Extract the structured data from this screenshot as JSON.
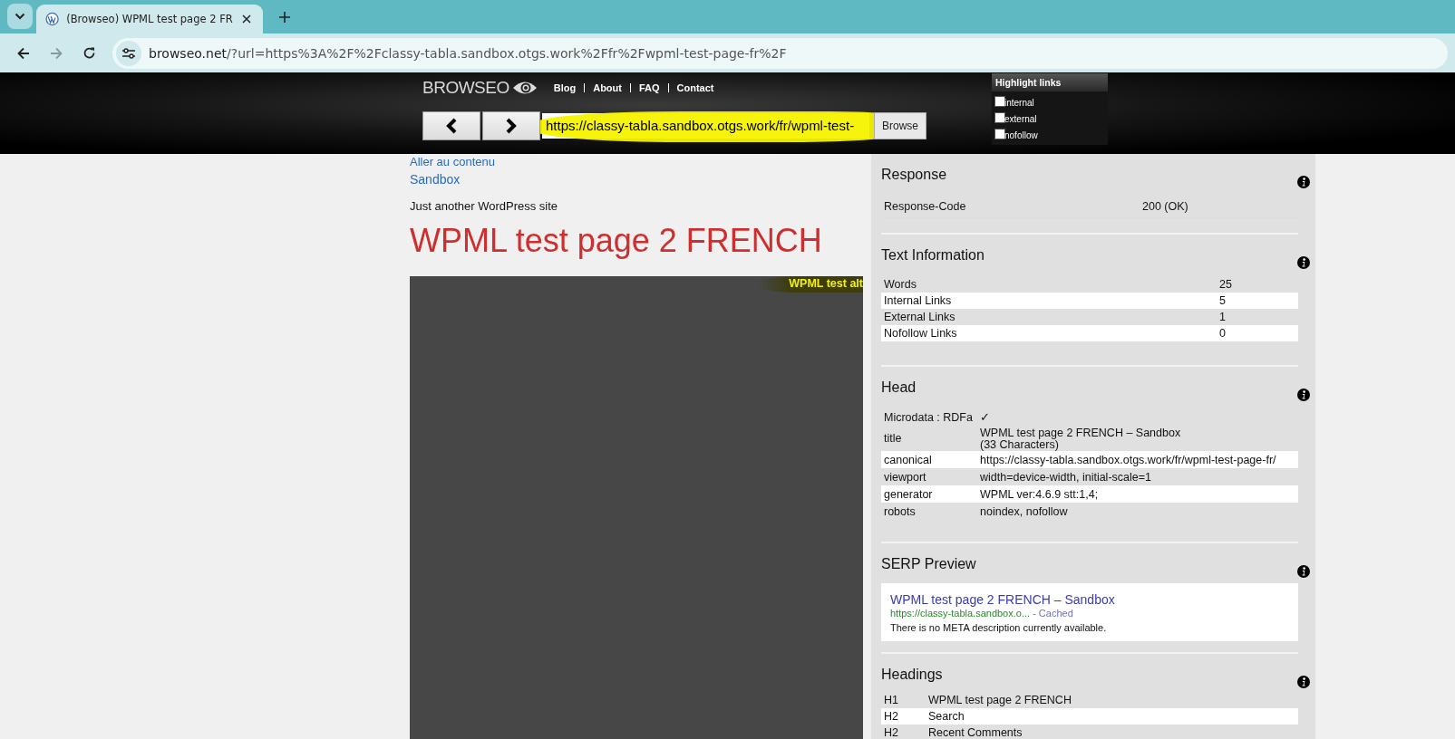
{
  "browser": {
    "tab": {
      "title": "(Browseo) WPML test page 2 FR"
    },
    "address": {
      "host": "browseo.net",
      "path": "/?url=https%3A%2F%2Fclassy-tabla.sandbox.otgs.work%2Ffr%2Fwpml-test-page-fr%2F"
    }
  },
  "header": {
    "logo": "BROWSEO",
    "nav": [
      "Blog",
      "About",
      "FAQ",
      "Contact"
    ],
    "url_field": {
      "value": "https://classy-tabla.sandbox.otgs.work/fr/wpml-test-"
    },
    "browse_button": "Browse",
    "highlight_links": {
      "title": "Highlight links",
      "options": [
        {
          "label": "internal",
          "checked": false
        },
        {
          "label": "external",
          "checked": false
        },
        {
          "label": "nofollow",
          "checked": false
        }
      ]
    }
  },
  "page": {
    "skip_link": "Aller au contenu",
    "site_title": "Sandbox",
    "tagline": "Just another WordPress site",
    "heading": "WPML test page 2 FRENCH",
    "image_alt": "WPML test alt"
  },
  "panel": [
    {
      "kind": "response",
      "title": "Response",
      "rows": [
        {
          "label": "Response-Code",
          "value": "200 (OK)"
        }
      ]
    },
    {
      "kind": "stats",
      "title": "Text Information",
      "rows": [
        {
          "label": "Words",
          "value": "25"
        },
        {
          "label": "Internal Links",
          "value": "5"
        },
        {
          "label": "External Links",
          "value": "1"
        },
        {
          "label": "Nofollow Links",
          "value": "0"
        }
      ]
    },
    {
      "kind": "head",
      "title": "Head",
      "rows": [
        {
          "label": "Microdata : RDFa",
          "value": "✓"
        },
        {
          "label": "title",
          "value": "WPML test page 2 FRENCH – Sandbox",
          "note": "(33 Characters)"
        },
        {
          "label": "canonical",
          "value": "https://classy-tabla.sandbox.otgs.work/fr/wpml-test-page-fr/"
        },
        {
          "label": "viewport",
          "value": "width=device-width, initial-scale=1"
        },
        {
          "label": "generator",
          "value": "WPML ver:4.6.9 stt:1,4;"
        },
        {
          "label": "robots",
          "value": "noindex, nofollow"
        }
      ]
    },
    {
      "kind": "serp",
      "title": "SERP Preview",
      "serp": {
        "title": "WPML test page 2 FRENCH – Sandbox",
        "url": "https://classy-tabla.sandbox.o...",
        "cached": "- Cached",
        "description": "There is no META description currently available."
      }
    },
    {
      "kind": "headings",
      "title": "Headings",
      "rows": [
        {
          "label": "H1",
          "value": "WPML test page 2 FRENCH"
        },
        {
          "label": "H2",
          "value": "Search"
        },
        {
          "label": "H2",
          "value": "Recent Comments"
        }
      ]
    }
  ]
}
